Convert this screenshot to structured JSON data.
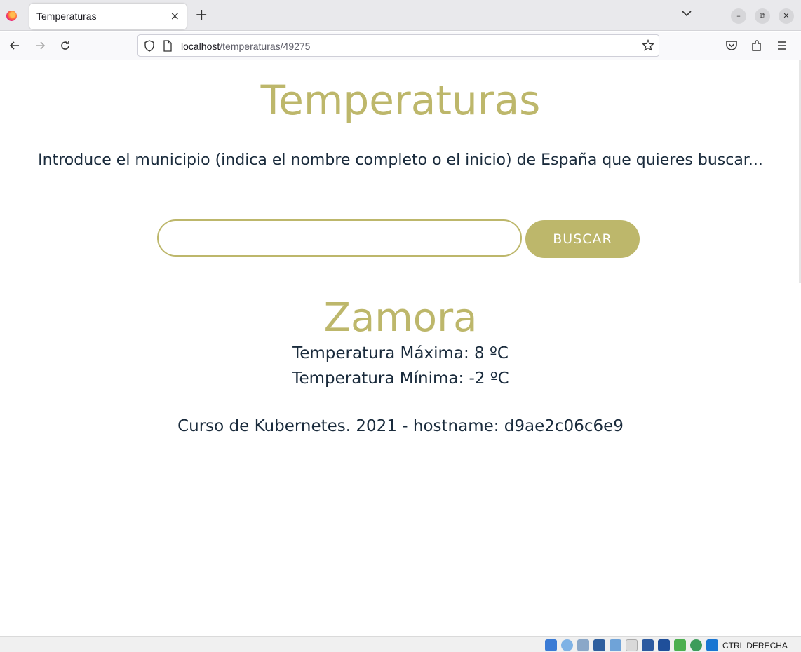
{
  "browser": {
    "tab_title": "Temperaturas",
    "tab_close": "×",
    "new_tab": "+",
    "url_host": "localhost",
    "url_path": "/temperaturas/49275"
  },
  "page": {
    "title": "Temperaturas",
    "intro": "Introduce el municipio (indica el nombre completo o el inicio) de España que quieres buscar...",
    "search_value": "",
    "search_button": "BUSCAR",
    "city": "Zamora",
    "temp_max": "Temperatura Máxima: 8 ºC",
    "temp_min": "Temperatura Mínima: -2 ºC",
    "footer": "Curso de Kubernetes. 2021 - hostname: d9ae2c06c6e9"
  },
  "vm_statusbar": {
    "host_key": "CTRL DERECHA"
  },
  "colors": {
    "accent": "#bdb76b",
    "text": "#1a2b3c"
  }
}
